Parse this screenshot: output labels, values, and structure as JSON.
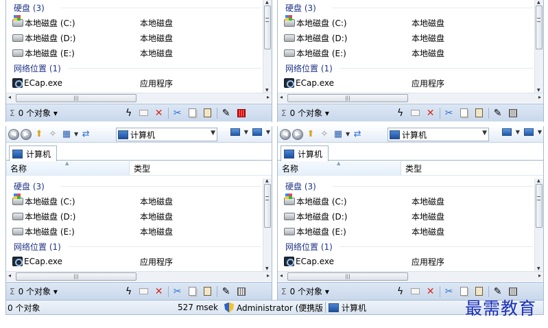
{
  "panes": [
    {
      "id": "top-left"
    },
    {
      "id": "top-right"
    },
    {
      "id": "bottom-left"
    },
    {
      "id": "bottom-right"
    }
  ],
  "nav": {
    "back": "back-icon",
    "forward": "forward-icon",
    "up": "folder-up-icon",
    "address": "计算机",
    "view": "view-icon"
  },
  "tab": {
    "label": "计算机"
  },
  "columns": {
    "name": "名称",
    "type": "类型"
  },
  "groups": {
    "disks": "硬盘 (3)",
    "network": "网络位置 (1)"
  },
  "items": [
    {
      "name": "本地磁盘 (C:)",
      "type": "本地磁盘",
      "icon": "system-drive-icon"
    },
    {
      "name": "本地磁盘 (D:)",
      "type": "本地磁盘",
      "icon": "drive-icon"
    },
    {
      "name": "本地磁盘 (E:)",
      "type": "本地磁盘",
      "icon": "drive-icon"
    }
  ],
  "network_item": {
    "name": "ECap.exe",
    "type": "应用程序",
    "icon": "exe-icon"
  },
  "footer": {
    "count": "0 个对象"
  },
  "status": {
    "objects": "0 个对象",
    "time": "527 msek",
    "user": "Administrator (便携版",
    "location": "计算机"
  },
  "watermark": "最需教育"
}
